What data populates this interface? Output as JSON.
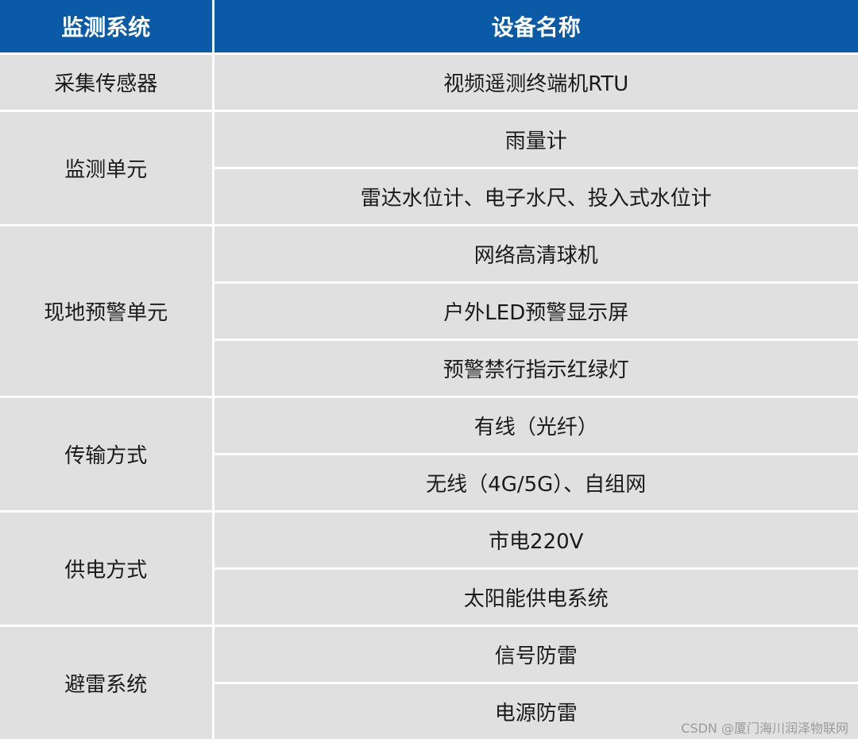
{
  "header": {
    "system": "监测系统",
    "device": "设备名称"
  },
  "colors": {
    "header_bg": "#0a5aa8",
    "cell_bg": "#e0e0e0"
  },
  "groups": [
    {
      "system": "采集传感器",
      "devices": [
        "视频遥测终端机RTU"
      ]
    },
    {
      "system": "监测单元",
      "devices": [
        "雨量计",
        "雷达水位计、电子水尺、投入式水位计"
      ]
    },
    {
      "system": "现地预警单元",
      "devices": [
        "网络高清球机",
        "户外LED预警显示屏",
        "预警禁行指示红绿灯"
      ]
    },
    {
      "system": "传输方式",
      "devices": [
        "有线（光纤）",
        "无线（4G/5G）、自组网"
      ]
    },
    {
      "system": "供电方式",
      "devices": [
        "市电220V",
        "太阳能供电系统"
      ]
    },
    {
      "system": "避雷系统",
      "devices": [
        "信号防雷",
        "电源防雷"
      ]
    }
  ],
  "watermark": "CSDN @厦门海川润泽物联网"
}
